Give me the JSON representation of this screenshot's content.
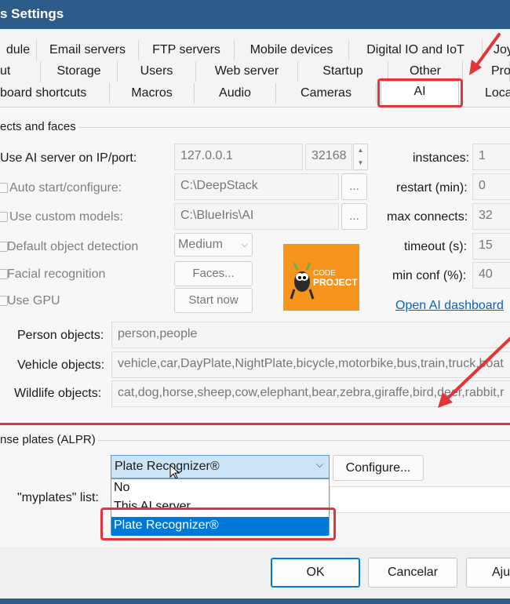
{
  "window": {
    "title": "s Settings"
  },
  "tabs": {
    "row1": [
      "dule",
      "Email servers",
      "FTP servers",
      "Mobile devices",
      "Digital IO and IoT",
      "Joy"
    ],
    "row2": [
      "ut",
      "Storage",
      "Users",
      "Web server",
      "Startup",
      "Other",
      "Pro"
    ],
    "row3": [
      "board shortcuts",
      "Macros",
      "Audio",
      "Cameras",
      "AI",
      "Loca"
    ]
  },
  "objects": {
    "group_label": "ects and faces",
    "use_ai_label": "Use AI server on IP/port:",
    "ip": "127.0.0.1",
    "port": "32168",
    "auto_start_label": "Auto start/configure:",
    "auto_start_path": "C:\\DeepStack",
    "custom_models_label": "Use custom models:",
    "custom_models_path": "C:\\BlueIris\\AI",
    "browse_label": "...",
    "default_detection_label": "Default object detection",
    "default_detection_value": "Medium",
    "facial_label": "Facial recognition",
    "faces_button": "Faces...",
    "gpu_label": "Use GPU",
    "start_now_button": "Start now",
    "instances_label": "instances:",
    "instances_value": "1",
    "restart_label": "restart (min):",
    "restart_value": "0",
    "max_connects_label": "max connects:",
    "max_connects_value": "32",
    "timeout_label": "timeout (s):",
    "timeout_value": "15",
    "min_conf_label": "min conf (%):",
    "min_conf_value": "40",
    "dashboard_link": "Open AI dashboard",
    "logo_text_1": "CODE",
    "logo_text_2": "PROJECT",
    "person_label": "Person objects:",
    "person_value": "person,people",
    "vehicle_label": "Vehicle objects:",
    "vehicle_value": "vehicle,car,DayPlate,NightPlate,bicycle,motorbike,bus,train,truck,boat",
    "wildlife_label": "Wildlife objects:",
    "wildlife_value": "cat,dog,horse,sheep,cow,elephant,bear,zebra,giraffe,bird,deer,rabbit,r"
  },
  "alpr": {
    "group_label": "nse plates (ALPR)",
    "selected": "Plate Recognizer®",
    "configure_button": "Configure...",
    "myplates_label": "\"myplates\" list:",
    "options": [
      "No",
      "This AI server",
      "Plate Recognizer®"
    ]
  },
  "footer": {
    "ok": "OK",
    "cancel": "Cancelar",
    "help": "Aju"
  },
  "colors": {
    "titlebar": "#2e5c8a",
    "highlight_red": "#e0353a",
    "selection_blue": "#0078d7",
    "link": "#0563c1",
    "logo_orange": "#f7941d"
  }
}
